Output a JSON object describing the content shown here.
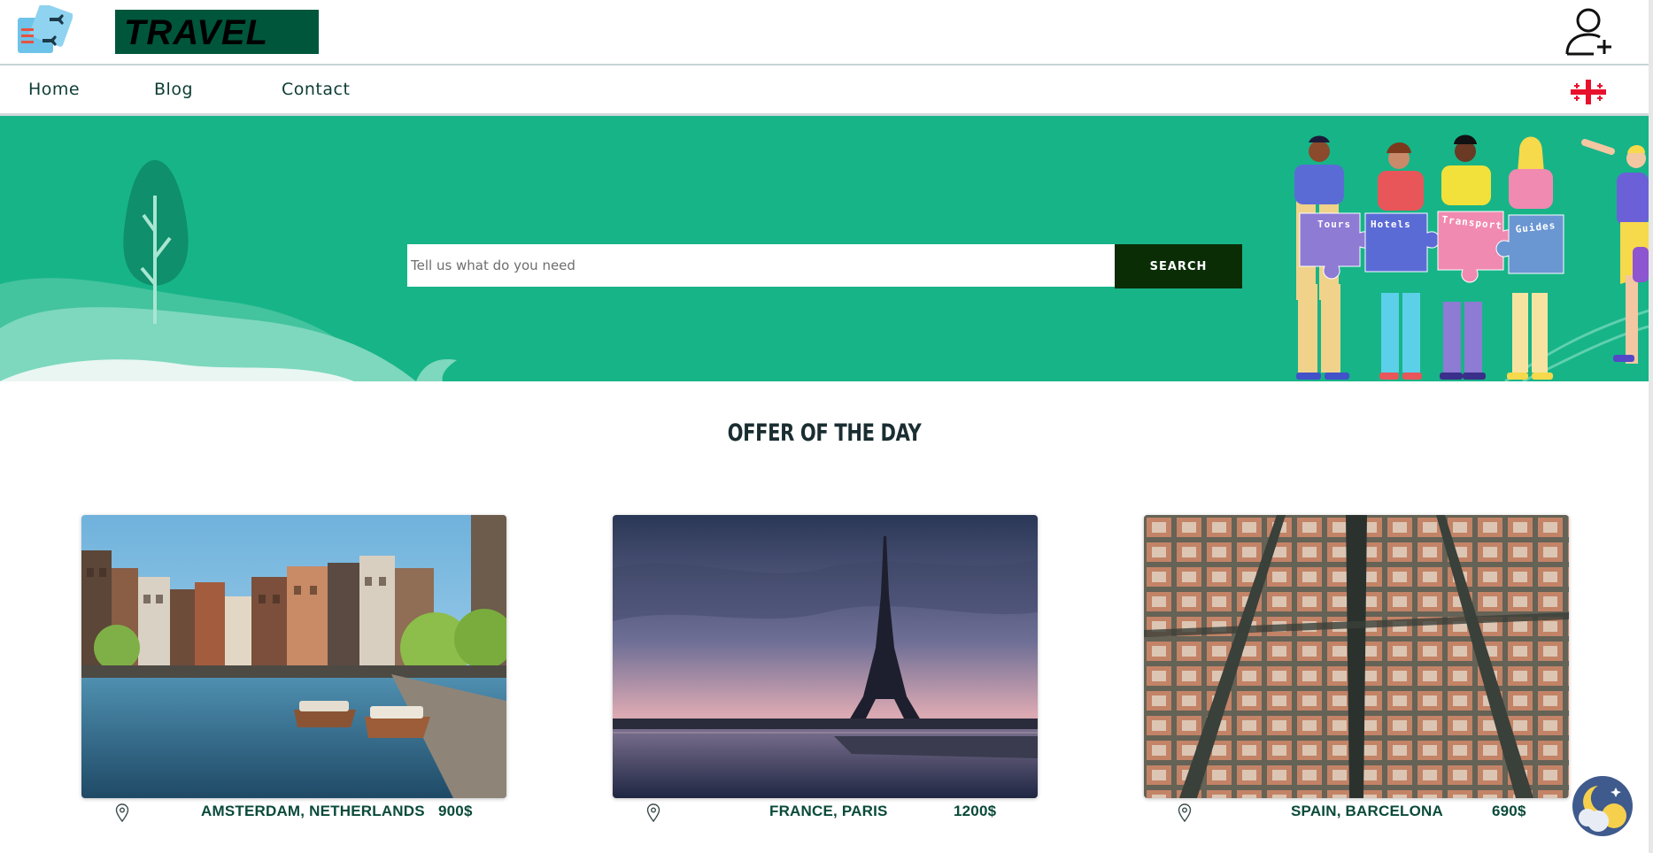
{
  "header": {
    "brand": "TRAVEL",
    "logo_icon": "travel-tickets-icon",
    "user_icon": "user-add-icon",
    "brand_color": "#00563b"
  },
  "nav": {
    "items": [
      {
        "label": "Home"
      },
      {
        "label": "Blog"
      },
      {
        "label": "Contact"
      }
    ],
    "language_icon": "georgia-flag-icon"
  },
  "hero": {
    "search": {
      "placeholder": "Tell us what do you need",
      "value": ""
    },
    "search_button": "SEARCH",
    "puzzle_labels": [
      "Tours",
      "Hotels",
      "Transport",
      "Guides"
    ],
    "background_color": "#17b488",
    "button_color": "#0b2d06"
  },
  "offers": {
    "title": "OFFER OF THE DAY",
    "cards": [
      {
        "location": "AMSTERDAM, NETHERLANDS",
        "price": "900$",
        "icon": "location-pin-icon"
      },
      {
        "location": "FRANCE, PARIS",
        "price": "1200$",
        "icon": "location-pin-icon"
      },
      {
        "location": "SPAIN, BARCELONA",
        "price": "690$",
        "icon": "location-pin-icon"
      }
    ]
  },
  "theme_toggle_icon": "moon-sun-icon"
}
